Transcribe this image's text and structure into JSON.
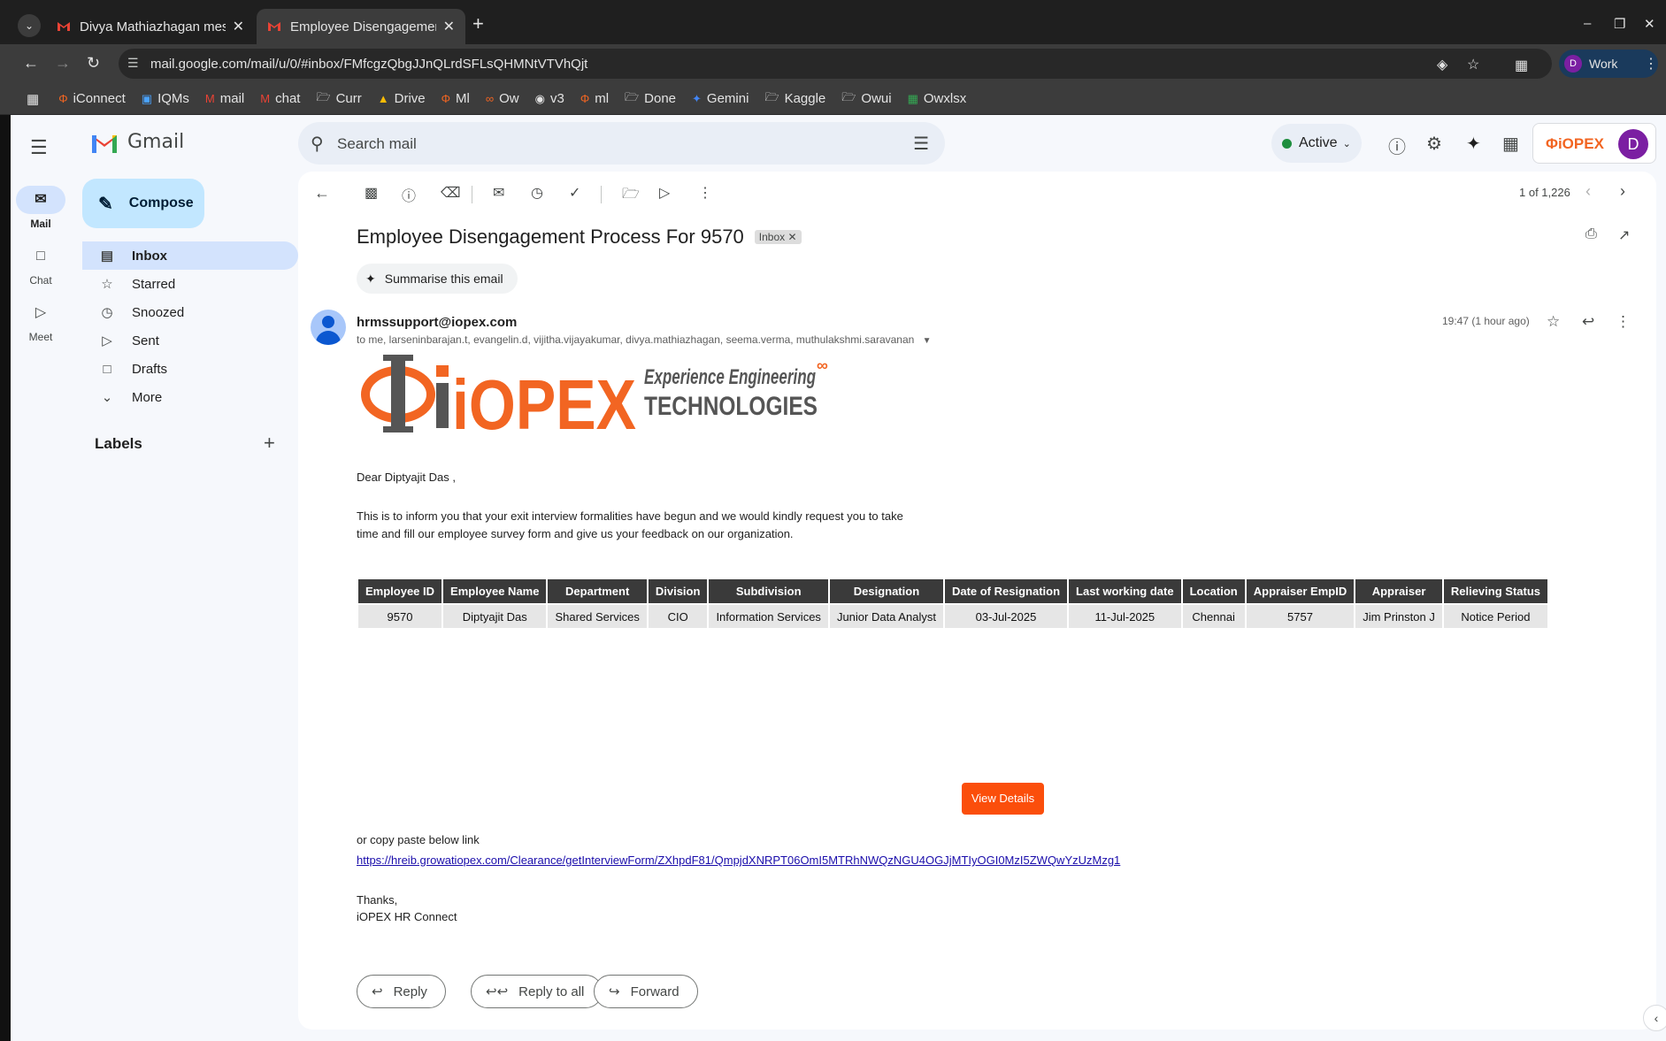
{
  "browser": {
    "tabs": [
      {
        "title": "Divya Mathiazhagan mes",
        "active": false
      },
      {
        "title": "Employee Disengagemen",
        "active": true
      }
    ],
    "url": "mail.google.com/mail/u/0/#inbox/FMfcgzQbgJJnQLrdSFLsQHMNtVTVhQjt",
    "profile_label": "Work",
    "profile_initial": "D",
    "bookmarks": [
      {
        "label": "iConnect",
        "icon": "iopex-icon"
      },
      {
        "label": "IQMs",
        "icon": "iqms-icon"
      },
      {
        "label": "mail",
        "icon": "gmail-icon"
      },
      {
        "label": "chat",
        "icon": "gmail-icon"
      },
      {
        "label": "Curr",
        "icon": "folder-icon"
      },
      {
        "label": "Drive",
        "icon": "drive-icon"
      },
      {
        "label": "Ml",
        "icon": "iopex-icon"
      },
      {
        "label": "Ow",
        "icon": "ow-icon"
      },
      {
        "label": "v3",
        "icon": "globe-icon"
      },
      {
        "label": "ml",
        "icon": "iopex-icon"
      },
      {
        "label": "Done",
        "icon": "folder-icon"
      },
      {
        "label": "Gemini",
        "icon": "gemini-icon"
      },
      {
        "label": "Kaggle",
        "icon": "folder-icon"
      },
      {
        "label": "Owui",
        "icon": "folder-icon"
      },
      {
        "label": "Owxlsx",
        "icon": "sheets-icon"
      }
    ]
  },
  "gmail": {
    "app_name": "Gmail",
    "rail": [
      {
        "label": "Mail"
      },
      {
        "label": "Chat"
      },
      {
        "label": "Meet"
      }
    ],
    "compose_label": "Compose",
    "nav": [
      {
        "label": "Inbox",
        "icon": "inbox-icon"
      },
      {
        "label": "Starred",
        "icon": "star-icon"
      },
      {
        "label": "Snoozed",
        "icon": "clock-icon"
      },
      {
        "label": "Sent",
        "icon": "send-icon"
      },
      {
        "label": "Drafts",
        "icon": "draft-icon"
      },
      {
        "label": "More",
        "icon": "chevron-down-icon"
      }
    ],
    "labels_heading": "Labels",
    "search_placeholder": "Search mail",
    "status": "Active",
    "account_brand": "ΦiOPEX",
    "account_initial": "D"
  },
  "message": {
    "paging": "1 of 1,226",
    "subject": "Employee Disengagement Process For 9570",
    "tag": "Inbox",
    "summarise_label": "Summarise this email",
    "sender": "hrmssupport@iopex.com",
    "recipients": "to me, larseninbarajan.t, evangelin.d, vijitha.vijayakumar, divya.mathiazhagan, seema.verma, muthulakshmi.saravanan",
    "time": "19:47 (1 hour ago)",
    "logo": {
      "brand": "iOPEX",
      "tagline": "Experience Engineering",
      "subline": "TECHNOLOGIES"
    },
    "greeting": "Dear Diptyajit Das ,",
    "paragraph_1": "This is to inform you that your exit interview formalities have begun and we would kindly request you to take",
    "paragraph_2": "time and fill our employee survey form and give us your feedback on our organization.",
    "table": {
      "headers": [
        "Employee ID",
        "Employee Name",
        "Department",
        "Division",
        "Subdivision",
        "Designation",
        "Date of Resignation",
        "Last working date",
        "Location",
        "Appraiser EmpID",
        "Appraiser",
        "Relieving Status"
      ],
      "row": [
        "9570",
        "Diptyajit Das",
        "Shared Services",
        "CIO",
        "Information Services",
        "Junior Data Analyst",
        "03-Jul-2025",
        "11-Jul-2025",
        "Chennai",
        "5757",
        "Jim Prinston J",
        "Notice Period"
      ]
    },
    "view_details_label": "View Details",
    "copy_note": "or copy paste below link",
    "link": "https://hreib.growatiopex.com/Clearance/getInterviewForm/ZXhpdF81/QmpjdXNRPT06OmI5MTRhNWQzNGU4OGJjMTIyOGI0MzI5ZWQwYzUzMzg1",
    "signoff_1": "Thanks,",
    "signoff_2": "iOPEX HR Connect",
    "actions": [
      {
        "label": "Reply"
      },
      {
        "label": "Reply to all"
      },
      {
        "label": "Forward"
      }
    ]
  }
}
